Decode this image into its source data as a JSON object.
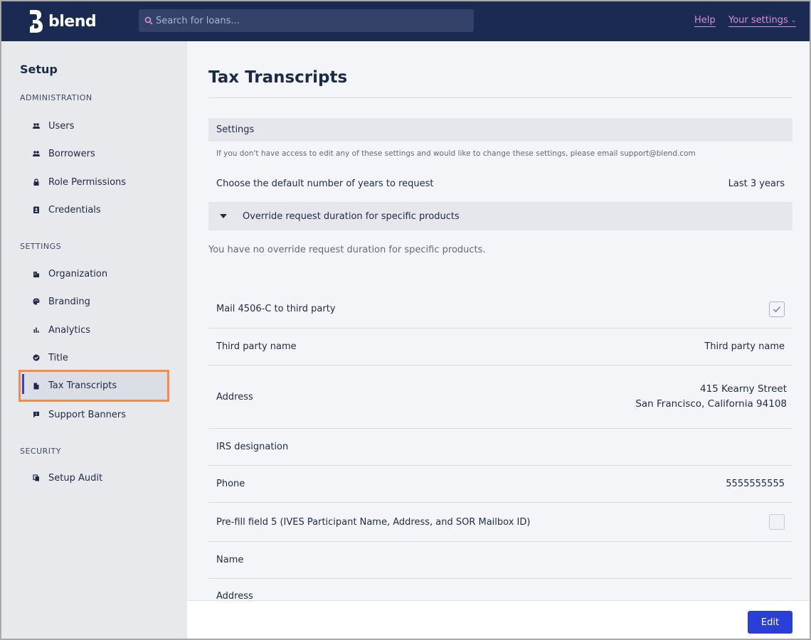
{
  "header": {
    "brand": "blend",
    "search_placeholder": "Search for loans...",
    "help_label": "Help",
    "settings_label": "Your settings"
  },
  "sidebar": {
    "title": "Setup",
    "sections": [
      {
        "label": "ADMINISTRATION",
        "items": [
          {
            "label": "Users",
            "icon": "people-icon"
          },
          {
            "label": "Borrowers",
            "icon": "people-icon"
          },
          {
            "label": "Role Permissions",
            "icon": "lock-icon"
          },
          {
            "label": "Credentials",
            "icon": "id-badge-icon"
          }
        ]
      },
      {
        "label": "SETTINGS",
        "items": [
          {
            "label": "Organization",
            "icon": "building-icon"
          },
          {
            "label": "Branding",
            "icon": "palette-icon"
          },
          {
            "label": "Analytics",
            "icon": "bar-chart-icon"
          },
          {
            "label": "Title",
            "icon": "verified-icon"
          },
          {
            "label": "Tax Transcripts",
            "icon": "document-icon",
            "active": true
          },
          {
            "label": "Support Banners",
            "icon": "chat-icon"
          }
        ]
      },
      {
        "label": "SECURITY",
        "items": [
          {
            "label": "Setup Audit",
            "icon": "copy-icon"
          }
        ]
      }
    ]
  },
  "main": {
    "title": "Tax Transcripts",
    "settings_header": "Settings",
    "note": "If you don't have access to edit any of these settings and would like to change these settings, please email support@blend.com",
    "default_years": {
      "label": "Choose the default number of years to request",
      "value": "Last 3 years"
    },
    "override": {
      "label": "Override request duration for specific products",
      "empty_message": "You have no override request duration for specific products."
    },
    "fields": {
      "mail_4506c": {
        "label": "Mail 4506-C to third party",
        "checked": true
      },
      "third_party_name": {
        "label": "Third party name",
        "value": "Third party name"
      },
      "address": {
        "label": "Address",
        "line1": "415 Kearny Street",
        "line2": "San Francisco, California 94108"
      },
      "irs_designation": {
        "label": "IRS designation",
        "value": ""
      },
      "phone": {
        "label": "Phone",
        "value": "5555555555"
      },
      "prefill_field5": {
        "label": "Pre-fill field 5 (IVES Participant Name, Address, and SOR Mailbox ID)",
        "checked": false
      },
      "name": {
        "label": "Name",
        "value": ""
      },
      "address2": {
        "label": "Address",
        "value": ""
      }
    }
  },
  "footer": {
    "edit_label": "Edit"
  },
  "colors": {
    "topbar": "#1a2a52",
    "link": "#d88fdc",
    "primary_button": "#2a3ed8",
    "highlight_border": "#f28c4b"
  }
}
